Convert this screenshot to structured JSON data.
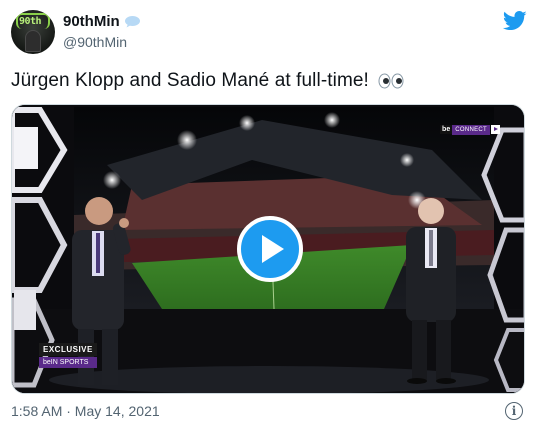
{
  "tweet": {
    "display_name": "90thMin",
    "handle": "@90thMin",
    "text": "Jürgen Klopp and Sadio Mané at full-time!",
    "emoji_icon": "eyes-emoji",
    "timestamp": "1:58 AM · May 14, 2021",
    "avatar_text": "90th"
  },
  "media": {
    "type": "video",
    "broadcaster_tag": {
      "brand": "be",
      "channel": "CONNECT"
    },
    "badge": {
      "top": "EXCLUSIVE",
      "bottom": "beIN SPORTS"
    },
    "play_icon": "play-icon"
  },
  "colors": {
    "twitter_blue": "#1d9bf0",
    "text_primary": "#0f1419",
    "text_secondary": "#536471",
    "bein_purple": "#5a2a8a"
  }
}
